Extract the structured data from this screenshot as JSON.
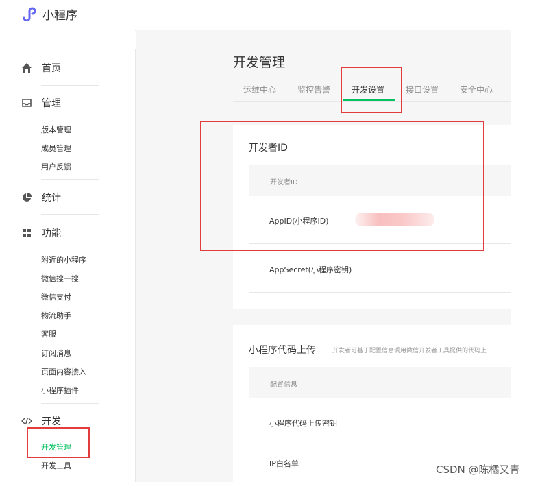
{
  "brand": {
    "name": "小程序",
    "accent": "#6467f0"
  },
  "sidebar": {
    "home": "首页",
    "manage": {
      "label": "管理",
      "items": [
        "版本管理",
        "成员管理",
        "用户反馈"
      ]
    },
    "stats": "统计",
    "features": {
      "label": "功能",
      "items": [
        "附近的小程序",
        "微信搜一搜",
        "微信支付",
        "物流助手",
        "客服",
        "订阅消息",
        "页面内容接入",
        "小程序插件"
      ]
    },
    "dev": {
      "label": "开发",
      "items": [
        "开发管理",
        "开发工具"
      ],
      "active": "开发管理"
    }
  },
  "main": {
    "title": "开发管理",
    "tabs": [
      "运维中心",
      "监控告警",
      "开发设置",
      "接口设置",
      "安全中心"
    ],
    "active_tab": "开发设置",
    "developer_id": {
      "title": "开发者ID",
      "header": "开发者ID",
      "rows": [
        "AppID(小程序ID)",
        "AppSecret(小程序密钥)"
      ]
    },
    "code_upload": {
      "title": "小程序代码上传",
      "description": "开发者可基于配置信息调用微信开发者工具提供的代码上",
      "header": "配置信息",
      "rows": [
        "小程序代码上传密钥",
        "IP白名单"
      ]
    }
  },
  "watermark": "CSDN @陈橘又青",
  "colors": {
    "accent_green": "#07c160",
    "highlight_red": "#e23c3c",
    "text": "#353535",
    "muted": "#8d8d8d"
  }
}
